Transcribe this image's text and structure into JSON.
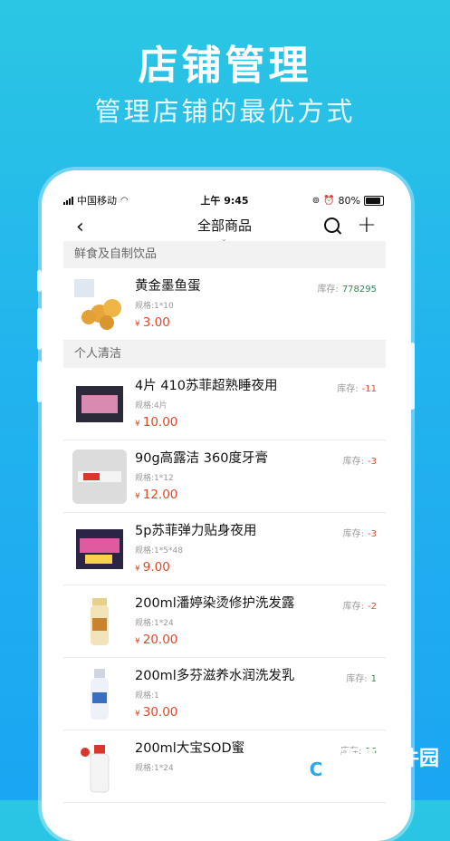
{
  "hero": {
    "title": "店铺管理",
    "subtitle": "管理店铺的最优方式"
  },
  "statusbar": {
    "carrier": "中国移动",
    "time": "上午 9:45",
    "battery": "80%",
    "battery_level": 0.8
  },
  "navbar": {
    "title": "全部商品",
    "back_icon": "chevron-left-icon",
    "search_icon": "search-icon",
    "add_icon": "plus-icon"
  },
  "sections": [
    {
      "title": "鲜食及自制饮品",
      "items": [
        {
          "name": "黄金墨鱼蛋",
          "spec": "规格:1*10",
          "currency": "¥",
          "price": "3.00",
          "stock_label": "库存:",
          "stock": "778295"
        }
      ]
    },
    {
      "title": "个人清洁",
      "items": [
        {
          "name": "4片 410苏菲超熟睡夜用",
          "spec": "规格:4片",
          "currency": "¥",
          "price": "10.00",
          "stock_label": "库存:",
          "stock": "-11"
        },
        {
          "name": "90g高露洁 360度牙膏",
          "spec": "规格:1*12",
          "currency": "¥",
          "price": "12.00",
          "stock_label": "库存:",
          "stock": "-3"
        },
        {
          "name": "5p苏菲弹力贴身夜用",
          "spec": "规格:1*5*48",
          "currency": "¥",
          "price": "9.00",
          "stock_label": "库存:",
          "stock": "-3"
        },
        {
          "name": "200ml潘婷染烫修护洗发露",
          "spec": "规格:1*24",
          "currency": "¥",
          "price": "20.00",
          "stock_label": "库存:",
          "stock": "-2"
        },
        {
          "name": "200ml多芬滋养水润洗发乳",
          "spec": "规格:1",
          "currency": "¥",
          "price": "30.00",
          "stock_label": "库存:",
          "stock": "1"
        },
        {
          "name": "200ml大宝SOD蜜",
          "spec": "规格:1*24",
          "currency": "¥",
          "price": "",
          "stock_label": "库存:",
          "stock": "16"
        }
      ]
    }
  ],
  "watermark": {
    "text": "西西软件园",
    "url": "CR173.COM"
  }
}
